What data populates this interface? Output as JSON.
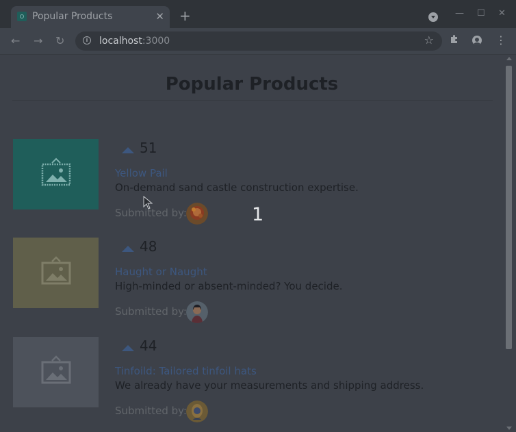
{
  "browser": {
    "tab_title": "Popular Products",
    "tab_close": "✕",
    "new_tab": "+",
    "url_host": "localhost",
    "url_port": ":3000",
    "icons": [
      "back-arrow-icon",
      "forward-arrow-icon",
      "reload-icon",
      "info-icon",
      "star-icon",
      "extensions-icon",
      "profile-icon",
      "menu-icon"
    ]
  },
  "page": {
    "title": "Popular Products",
    "submitted_label": "Submitted by:",
    "overlay_number": "1"
  },
  "products": [
    {
      "votes": "51",
      "name": "Yellow Pail",
      "description": "On-demand sand castle construction expertise.",
      "thumb_color": "#1f5e5a"
    },
    {
      "votes": "48",
      "name": "Haught or Naught",
      "description": "High-minded or absent-minded? You decide.",
      "thumb_color": "#605f4a"
    },
    {
      "votes": "44",
      "name": "Tinfoild: Tailored tinfoil hats",
      "description": "We already have your measurements and shipping address.",
      "thumb_color": "#4d525b"
    }
  ]
}
